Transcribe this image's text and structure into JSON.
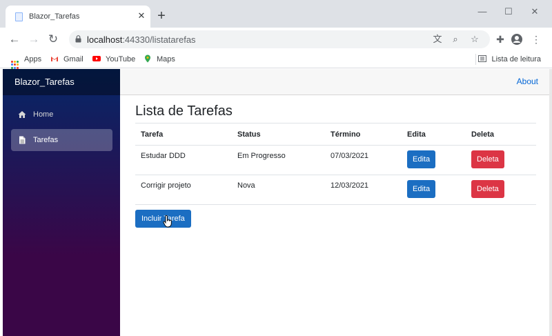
{
  "browser": {
    "tab_title": "Blazor_Tarefas",
    "url_host": "localhost",
    "url_path": ":44330/listatarefas",
    "bookmarks": [
      "Apps",
      "Gmail",
      "YouTube",
      "Maps"
    ],
    "reading_list": "Lista de leitura"
  },
  "sidebar": {
    "brand": "Blazor_Tarefas",
    "items": [
      {
        "label": "Home",
        "icon": "home-icon",
        "active": false
      },
      {
        "label": "Tarefas",
        "icon": "document-icon",
        "active": true
      }
    ]
  },
  "header": {
    "about_label": "About"
  },
  "main": {
    "title": "Lista de Tarefas",
    "columns": [
      "Tarefa",
      "Status",
      "Término",
      "Edita",
      "Deleta"
    ],
    "rows": [
      {
        "tarefa": "Estudar DDD",
        "status": "Em Progresso",
        "termino": "07/03/2021",
        "edit_label": "Edita",
        "delete_label": "Deleta"
      },
      {
        "tarefa": "Corrigir projeto",
        "status": "Nova",
        "termino": "12/03/2021",
        "edit_label": "Edita",
        "delete_label": "Deleta"
      }
    ],
    "add_button_label": "Incluir Tarefa"
  },
  "colors": {
    "primary": "#1b6ec2",
    "danger": "#dc3545",
    "sidebar_top": "#052767",
    "sidebar_bottom": "#3a0647",
    "link": "#0366d6"
  }
}
